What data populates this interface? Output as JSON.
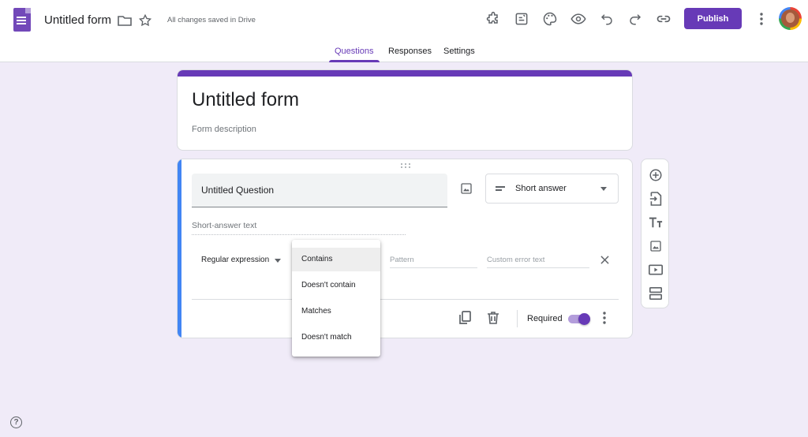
{
  "app": {
    "form_title": "Untitled form",
    "save_status": "All changes saved in Drive",
    "publish_label": "Publish"
  },
  "tabs": [
    {
      "label": "Questions",
      "active": true
    },
    {
      "label": "Responses",
      "active": false
    },
    {
      "label": "Settings",
      "active": false
    }
  ],
  "form": {
    "title": "Untitled form",
    "description_placeholder": "Form description"
  },
  "question": {
    "title": "Untitled Question",
    "type": "Short answer",
    "answer_placeholder": "Short-answer text",
    "validation_type": "Regular expression",
    "pattern_placeholder": "Pattern",
    "error_placeholder": "Custom error text",
    "required_label": "Required",
    "required": true
  },
  "dropdown": {
    "options": [
      "Contains",
      "Doesn't contain",
      "Matches",
      "Doesn't match"
    ],
    "selected": "Contains"
  },
  "help_glyph": "?",
  "colors": {
    "accent": "#673ab7",
    "background": "#f0ebf8",
    "question_strip": "#4285f4"
  }
}
